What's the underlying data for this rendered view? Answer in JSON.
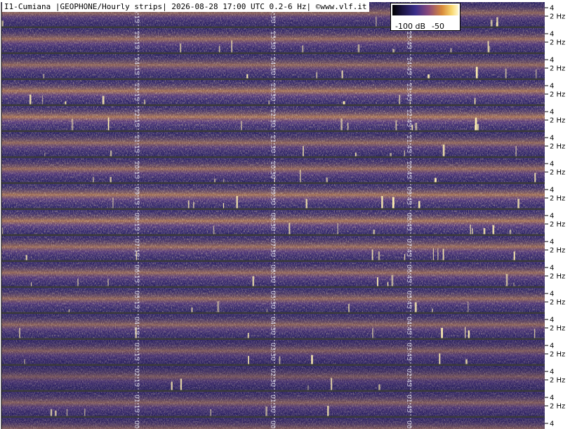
{
  "title": "I1-Cumiana |GEOPHONE/Hourly strips| 2026-08-28 17:00 UTC 0.2-6 Hz| ©www.vlf.it",
  "colorbar": {
    "low_label": "-100 dB",
    "high_label": "-50"
  },
  "colors": {
    "background": "#0f0a28",
    "low": "#2a2370",
    "mid": "#7a4a8a",
    "high": "#e89a3a",
    "peak": "#fff0b0",
    "separator": "#3a3a3a",
    "marker": "#ffffff"
  },
  "chart_data": {
    "type": "heatmap",
    "title": "I1-Cumiana |GEOPHONE/Hourly strips| 2026-08-28 17:00 UTC 0.2-6 Hz| ©www.vlf.it",
    "y_tick_labels": [
      "4",
      "2 Hz"
    ],
    "strips": [
      {
        "hour": "16",
        "marks": [
          "16:15",
          "16:30",
          "16:45"
        ],
        "activity": 0.45
      },
      {
        "hour": "15",
        "marks": [
          "15:15",
          "15:30",
          "15:45"
        ],
        "activity": 0.55
      },
      {
        "hour": "14",
        "marks": [
          "14:15",
          "14:30",
          "14:45"
        ],
        "activity": 0.5
      },
      {
        "hour": "13",
        "marks": [
          "13:15",
          "13:30",
          "13:45"
        ],
        "activity": 0.7
      },
      {
        "hour": "12",
        "marks": [
          "12:15",
          "12:30",
          "12:45"
        ],
        "activity": 0.75
      },
      {
        "hour": "11",
        "marks": [
          "11:15",
          "11:30",
          "11:45"
        ],
        "activity": 0.5
      },
      {
        "hour": "10",
        "marks": [
          "10:15",
          "10:30",
          "10:45"
        ],
        "activity": 0.55
      },
      {
        "hour": "09",
        "marks": [
          "09:15",
          "09:30",
          "09:45"
        ],
        "activity": 0.7
      },
      {
        "hour": "08",
        "marks": [
          "08:15",
          "08:30",
          "08:45"
        ],
        "activity": 0.72
      },
      {
        "hour": "07",
        "marks": [
          "07:15",
          "07:30",
          "07:45"
        ],
        "activity": 0.6
      },
      {
        "hour": "06",
        "marks": [
          "06:15",
          "06:30",
          "06:45"
        ],
        "activity": 0.55
      },
      {
        "hour": "05",
        "marks": [
          "05:15",
          "05:30",
          "05:45"
        ],
        "activity": 0.5
      },
      {
        "hour": "04",
        "marks": [
          "04:15",
          "04:30",
          "04:45"
        ],
        "activity": 0.45
      },
      {
        "hour": "03",
        "marks": [
          "03:15",
          "03:30",
          "03:45"
        ],
        "activity": 0.3
      },
      {
        "hour": "02",
        "marks": [
          "02:15",
          "02:30",
          "02:45"
        ],
        "activity": 0.22
      },
      {
        "hour": "01",
        "marks": [
          "01:15",
          "01:30",
          "01:45"
        ],
        "activity": 0.35
      },
      {
        "hour": "00",
        "marks": [
          "00:15",
          "00:30",
          "00:45"
        ],
        "activity": 0.3
      }
    ]
  }
}
